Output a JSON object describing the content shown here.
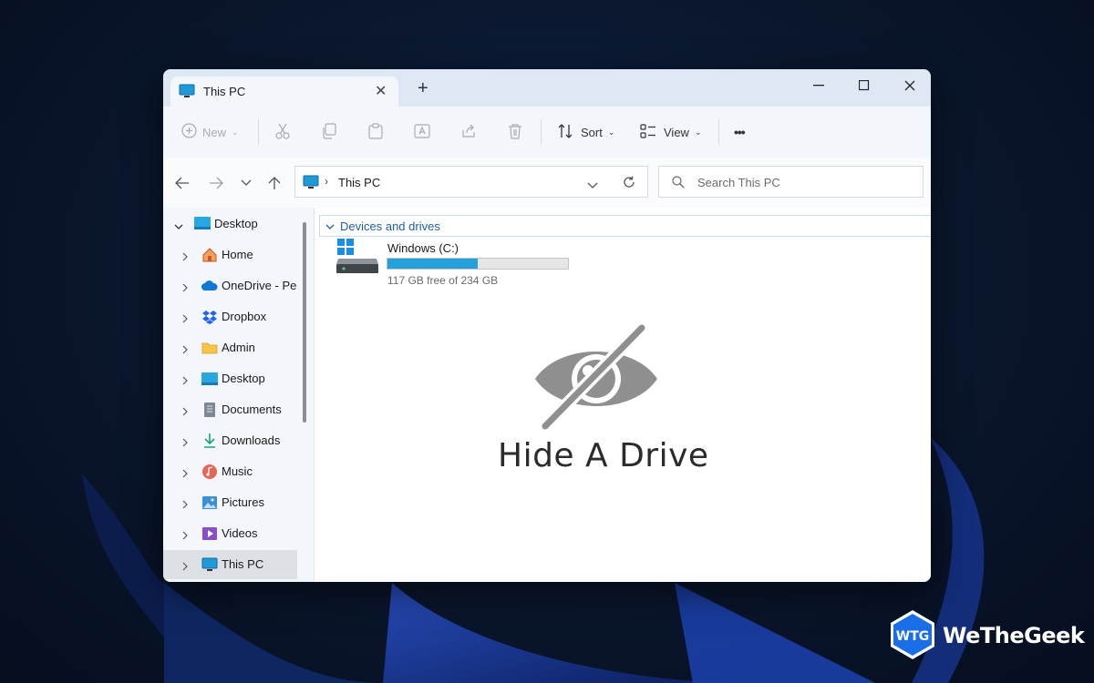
{
  "tab": {
    "title": "This PC",
    "new_tab": "+"
  },
  "toolbar": {
    "new_label": "New",
    "sort_label": "Sort",
    "view_label": "View",
    "more_label": "•••"
  },
  "address": {
    "path": "This PC"
  },
  "search": {
    "placeholder": "Search This PC"
  },
  "sidebar": {
    "items": [
      {
        "label": "Desktop",
        "icon": "desktop-icon",
        "expanded": true
      },
      {
        "label": "Home",
        "icon": "home-icon"
      },
      {
        "label": "OneDrive - Personal",
        "icon": "onedrive-icon"
      },
      {
        "label": "Dropbox",
        "icon": "dropbox-icon"
      },
      {
        "label": "Admin",
        "icon": "folder-icon"
      },
      {
        "label": "Desktop",
        "icon": "desktop-folder-icon"
      },
      {
        "label": "Documents",
        "icon": "documents-icon"
      },
      {
        "label": "Downloads",
        "icon": "downloads-icon"
      },
      {
        "label": "Music",
        "icon": "music-icon"
      },
      {
        "label": "Pictures",
        "icon": "pictures-icon"
      },
      {
        "label": "Videos",
        "icon": "videos-icon"
      },
      {
        "label": "This PC",
        "icon": "this-pc-icon",
        "selected": true
      }
    ]
  },
  "content": {
    "group_header": "Devices and drives",
    "drive": {
      "name": "Windows (C:)",
      "free_text": "117 GB free of 234 GB",
      "used_fraction": 0.5
    }
  },
  "overlay": {
    "title": "Hide A Drive",
    "icon": "eye-slash-icon"
  },
  "brand": {
    "name": "WeTheGeek",
    "monogram": "WTG"
  },
  "colors": {
    "accent": "#26a0da",
    "group_header": "#1f5fa6",
    "brand_blue": "#1a6fe8"
  }
}
